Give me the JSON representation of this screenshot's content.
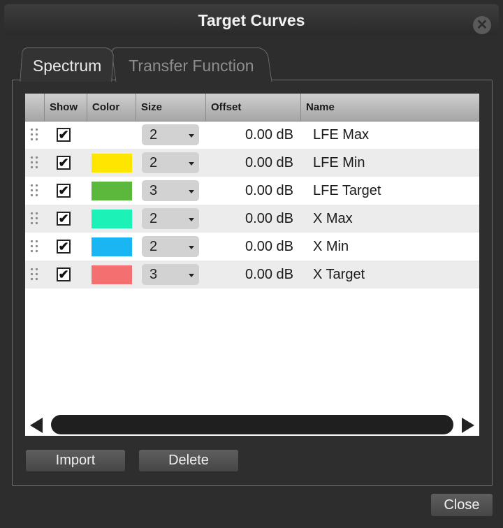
{
  "window": {
    "title": "Target Curves",
    "close_glyph": "✕"
  },
  "tabs": [
    {
      "label": "Spectrum",
      "active": true
    },
    {
      "label": "Transfer Function",
      "active": false
    }
  ],
  "table": {
    "columns": [
      "Show",
      "Color",
      "Size",
      "Offset",
      "Name"
    ],
    "rows": [
      {
        "show": true,
        "color": "",
        "size": "2",
        "offset": "0.00 dB",
        "name": "LFE Max"
      },
      {
        "show": true,
        "color": "#ffe600",
        "size": "2",
        "offset": "0.00 dB",
        "name": "LFE Min"
      },
      {
        "show": true,
        "color": "#5cb83c",
        "size": "3",
        "offset": "0.00 dB",
        "name": "LFE Target"
      },
      {
        "show": true,
        "color": "#1cf2b8",
        "size": "2",
        "offset": "0.00 dB",
        "name": "X Max"
      },
      {
        "show": true,
        "color": "#1ab6f4",
        "size": "2",
        "offset": "0.00 dB",
        "name": "X Min"
      },
      {
        "show": true,
        "color": "#f46f6f",
        "size": "3",
        "offset": "0.00 dB",
        "name": "X Target"
      }
    ],
    "checkmark": "✔"
  },
  "buttons": {
    "import": "Import",
    "delete": "Delete",
    "close": "Close"
  }
}
